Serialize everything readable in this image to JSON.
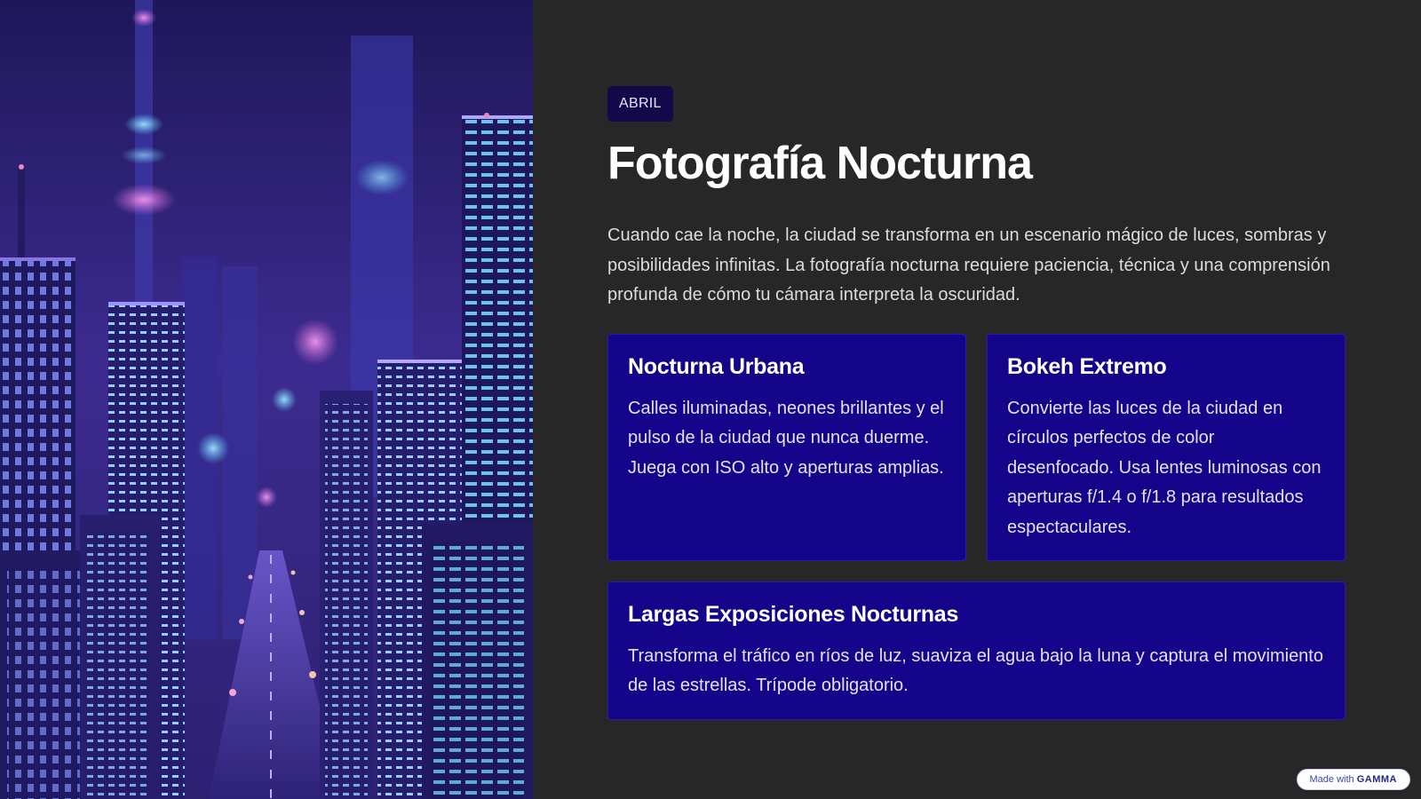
{
  "hero": {
    "image_name": "neon-city-night-illustration",
    "colors": {
      "sky_top": "#1a1450",
      "sky_mid": "#3a2a8a",
      "glow_pink": "#e06ad8",
      "glow_cyan": "#56d8ff",
      "building_dark": "#17124a"
    }
  },
  "slide": {
    "tag": "ABRIL",
    "title": "Fotografía Nocturna",
    "lead": "Cuando cae la noche, la ciudad se transforma en un escenario mágico de luces, sombras y posibilidades infinitas. La fotografía nocturna requiere paciencia, técnica y una comprensión profunda de cómo tu cámara interpreta la oscuridad."
  },
  "cards": [
    {
      "title": "Nocturna Urbana",
      "text": "Calles iluminadas, neones brillantes y el pulso de la ciudad que nunca duerme. Juega con ISO alto y aperturas amplias."
    },
    {
      "title": "Bokeh Extremo",
      "text": "Convierte las luces de la ciudad en círculos perfectos de color desenfocado. Usa lentes luminosas con aperturas f/1.4 o f/1.8 para resultados espectaculares."
    },
    {
      "title": "Largas Exposiciones Nocturnas",
      "text": "Transforma el tráfico en ríos de luz, suaviza el agua bajo la luna y captura el movimiento de las estrellas. Trípode obligatorio."
    }
  ],
  "badge": {
    "prefix": "Made with",
    "brand": "GAMMA"
  },
  "theme": {
    "background": "#272727",
    "card": "#13048a",
    "tag_bg": "#14084a"
  }
}
